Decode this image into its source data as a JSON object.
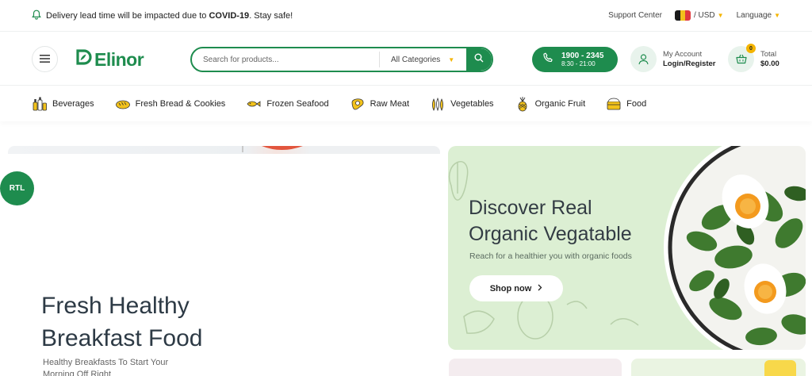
{
  "topbar": {
    "notice_prefix": "Delivery lead time will be impacted due to ",
    "notice_bold": "COVID-19",
    "notice_suffix": ". Stay safe!",
    "support": "Support Center",
    "currency": "/ USD",
    "language": "Language",
    "icons": {
      "notice": "bell-icon",
      "flag": "belgium-flag-icon"
    }
  },
  "header": {
    "logo_text": "Elinor",
    "search": {
      "placeholder": "Search for products...",
      "category": "All Categories"
    },
    "hotline": {
      "number": "1900 - 2345",
      "hours": "8:30 - 21:00"
    },
    "account": {
      "line1": "My Account",
      "line2": "Login/Register"
    },
    "cart": {
      "count": "0",
      "label": "Total",
      "amount": "$0.00"
    }
  },
  "categories": [
    {
      "label": "Beverages",
      "icon": "bottles-icon"
    },
    {
      "label": "Fresh Bread & Cookies",
      "icon": "bread-icon"
    },
    {
      "label": "Frozen Seafood",
      "icon": "fish-icon"
    },
    {
      "label": "Raw Meat",
      "icon": "meat-icon"
    },
    {
      "label": "Vegetables",
      "icon": "vegetables-icon"
    },
    {
      "label": "Organic Fruit",
      "icon": "pineapple-icon"
    },
    {
      "label": "Food",
      "icon": "food-box-icon"
    }
  ],
  "hero_main": {
    "title": "Fresh Healthy Breakfast Food",
    "subtitle": "Healthy Breakfasts To Start Your Morning Off Right"
  },
  "hero_side": {
    "title": "Discover Real Organic Vegatable",
    "subtitle": "Reach for a healthier you with organic foods",
    "button": "Shop now"
  },
  "rtl_label": "RTL",
  "colors": {
    "brand": "#1e8c4e",
    "accent": "#f4b400",
    "banner_bg": "#dcefd3"
  }
}
